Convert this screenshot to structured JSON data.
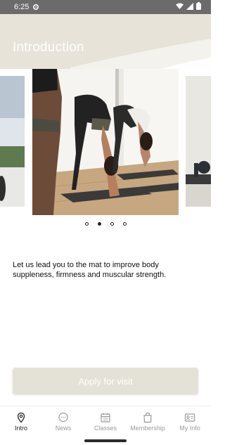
{
  "status_bar": {
    "time": "6:25",
    "icons": [
      "gear-icon",
      "wifi-icon",
      "signal-icon",
      "battery-icon"
    ]
  },
  "header": {
    "title": "Introduction",
    "background_color": "#e7e3d8"
  },
  "carousel": {
    "slide_count": 4,
    "active_index": 1
  },
  "description": "Let us lead you to the mat to improve body suppleness, firmness and muscular strength.",
  "apply_button": {
    "label": "Apply for visit"
  },
  "bottom_nav": {
    "items": [
      {
        "label": "Intro",
        "icon": "location-pin-icon",
        "active": true
      },
      {
        "label": "News",
        "icon": "chat-bubble-icon",
        "active": false
      },
      {
        "label": "Classes",
        "icon": "calendar-icon",
        "active": false
      },
      {
        "label": "Membership",
        "icon": "shopping-bag-icon",
        "active": false
      },
      {
        "label": "My Info",
        "icon": "id-card-icon",
        "active": false
      }
    ]
  },
  "colors": {
    "accent": "#e4e1d6",
    "active_nav": "#222222",
    "inactive_nav": "#9a9a9a"
  }
}
